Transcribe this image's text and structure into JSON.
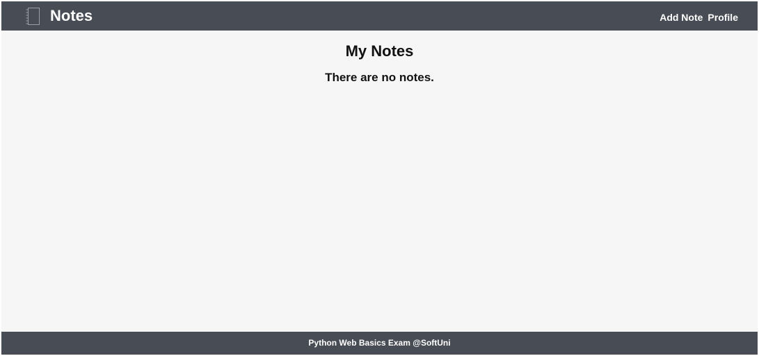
{
  "header": {
    "brand": "Notes",
    "logo_icon": "notebook-icon",
    "nav": {
      "add_note": "Add Note",
      "profile": "Profile"
    }
  },
  "main": {
    "title": "My Notes",
    "empty_message": "There are no notes."
  },
  "footer": {
    "text": "Python Web Basics Exam @SoftUni"
  },
  "colors": {
    "header_bg": "#484c55",
    "page_bg": "#f6f6f6",
    "text": "#111111"
  }
}
